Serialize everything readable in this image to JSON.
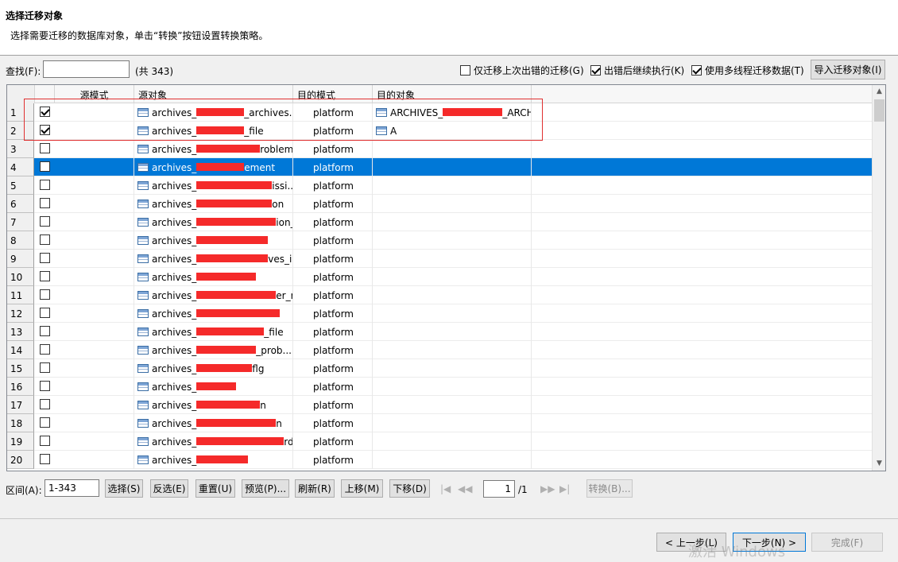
{
  "header": {
    "title": "选择迁移对象",
    "description": "选择需要迁移的数据库对象，单击“转换”按钮设置转换策略。"
  },
  "search": {
    "label": "查找(F):",
    "value": "",
    "count": "(共 343)"
  },
  "options": {
    "only_failed": {
      "label": "仅迁移上次出错的迁移(G)",
      "checked": false
    },
    "continue_on_error": {
      "label": "出错后继续执行(K)",
      "checked": true
    },
    "multithread": {
      "label": "使用多线程迁移数据(T)",
      "checked": true
    },
    "import_button": "导入迁移对象(I)"
  },
  "grid": {
    "columns": [
      "源模式",
      "源对象",
      "目的模式",
      "目的对象"
    ],
    "rows": [
      {
        "num": "1",
        "checked": true,
        "src_schema": "",
        "src_pre": "archives_",
        "src_post": "_archives...",
        "dst_schema": "platform",
        "dst_pre": "ARCHIVES_",
        "dst_post": "_ARCH"
      },
      {
        "num": "2",
        "checked": true,
        "src_schema": "",
        "src_pre": "archives_",
        "src_post": "_file",
        "dst_schema": "platform",
        "dst_pre": "A",
        "dst_post": ""
      },
      {
        "num": "3",
        "checked": false,
        "src_schema": "",
        "src_pre": "archives_",
        "src_post": "roblem",
        "dst_schema": "platform",
        "dst_pre": "",
        "dst_post": ""
      },
      {
        "num": "4",
        "checked": false,
        "src_schema": "",
        "src_pre": "archives_",
        "src_post": "ement",
        "dst_schema": "platform",
        "dst_pre": "",
        "dst_post": "",
        "selected": true
      },
      {
        "num": "5",
        "checked": false,
        "src_schema": "",
        "src_pre": "archives_",
        "src_post": "issi...",
        "dst_schema": "platform",
        "dst_pre": "",
        "dst_post": ""
      },
      {
        "num": "6",
        "checked": false,
        "src_schema": "",
        "src_pre": "archives_",
        "src_post": "on",
        "dst_schema": "platform",
        "dst_pre": "",
        "dst_post": ""
      },
      {
        "num": "7",
        "checked": false,
        "src_schema": "",
        "src_pre": "archives_",
        "src_post": "ion_d...",
        "dst_schema": "platform",
        "dst_pre": "",
        "dst_post": ""
      },
      {
        "num": "8",
        "checked": false,
        "src_schema": "",
        "src_pre": "archives_",
        "src_post": "",
        "dst_schema": "platform",
        "dst_pre": "",
        "dst_post": ""
      },
      {
        "num": "9",
        "checked": false,
        "src_schema": "",
        "src_pre": "archives_",
        "src_post": "ves_in...",
        "dst_schema": "platform",
        "dst_pre": "",
        "dst_post": ""
      },
      {
        "num": "10",
        "checked": false,
        "src_schema": "",
        "src_pre": "archives_",
        "src_post": "",
        "dst_schema": "platform",
        "dst_pre": "",
        "dst_post": ""
      },
      {
        "num": "11",
        "checked": false,
        "src_schema": "",
        "src_pre": "archives_",
        "src_post": "er_re",
        "dst_schema": "platform",
        "dst_pre": "",
        "dst_post": ""
      },
      {
        "num": "12",
        "checked": false,
        "src_schema": "",
        "src_pre": "archives_",
        "src_post": "",
        "dst_schema": "platform",
        "dst_pre": "",
        "dst_post": ""
      },
      {
        "num": "13",
        "checked": false,
        "src_schema": "",
        "src_pre": "archives_",
        "src_post": "_file",
        "dst_schema": "platform",
        "dst_pre": "",
        "dst_post": ""
      },
      {
        "num": "14",
        "checked": false,
        "src_schema": "",
        "src_pre": "archives_",
        "src_post": "_prob...",
        "dst_schema": "platform",
        "dst_pre": "",
        "dst_post": ""
      },
      {
        "num": "15",
        "checked": false,
        "src_schema": "",
        "src_pre": "archives_",
        "src_post": "flg",
        "dst_schema": "platform",
        "dst_pre": "",
        "dst_post": ""
      },
      {
        "num": "16",
        "checked": false,
        "src_schema": "",
        "src_pre": "archives_",
        "src_post": "",
        "dst_schema": "platform",
        "dst_pre": "",
        "dst_post": ""
      },
      {
        "num": "17",
        "checked": false,
        "src_schema": "",
        "src_pre": "archives_",
        "src_post": "n",
        "dst_schema": "platform",
        "dst_pre": "",
        "dst_post": ""
      },
      {
        "num": "18",
        "checked": false,
        "src_schema": "",
        "src_pre": "archives_",
        "src_post": "n",
        "dst_schema": "platform",
        "dst_pre": "",
        "dst_post": ""
      },
      {
        "num": "19",
        "checked": false,
        "src_schema": "",
        "src_pre": "archives_",
        "src_post": "rd",
        "dst_schema": "platform",
        "dst_pre": "",
        "dst_post": ""
      },
      {
        "num": "20",
        "checked": false,
        "src_schema": "",
        "src_pre": "archives_",
        "src_post": "",
        "dst_schema": "platform",
        "dst_pre": "",
        "dst_post": ""
      }
    ]
  },
  "toolbar": {
    "range_label": "区间(A):",
    "range_value": "1-343",
    "select": "选择(S)",
    "invert": "反选(E)",
    "reset": "重置(U)",
    "preview": "预览(P)...",
    "refresh": "刷新(R)",
    "move_up": "上移(M)",
    "move_down": "下移(D)",
    "page_value": "1",
    "page_total": "/1",
    "convert": "转换(B)..."
  },
  "footer": {
    "back": "< 上一步(L)",
    "next": "下一步(N) >",
    "finish": "完成(F)",
    "watermark": "激活 Windows"
  },
  "colors": {
    "selection": "#0078d7",
    "redaction": "#f52a2a",
    "highlight_box": "#e03030"
  },
  "icons": {
    "table": "table-icon",
    "first_page": "first-page-icon",
    "prev_page": "prev-page-icon",
    "next_page": "next-page-icon",
    "last_page": "last-page-icon"
  }
}
